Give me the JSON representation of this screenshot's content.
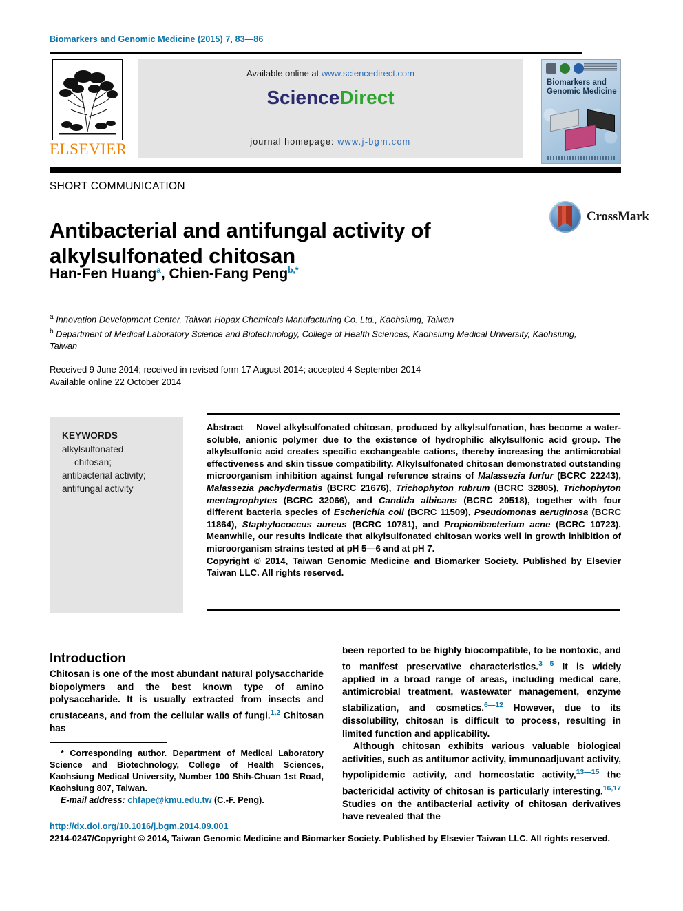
{
  "running_head": "Biomarkers and Genomic Medicine (2015) 7, 83—86",
  "masthead": {
    "available_prefix": "Available online at ",
    "available_url": "www.sciencedirect.com",
    "sciencedirect_science": "Science",
    "sciencedirect_direct": "Direct",
    "homepage_prefix": "journal homepage: ",
    "homepage_url": "www.j-bgm.com",
    "elsevier_label": "ELSEVIER",
    "cover_title": "Biomarkers and\nGenomic Medicine"
  },
  "article": {
    "type_label": "SHORT COMMUNICATION",
    "title": "Antibacterial and antifungal activity of alkylsulfonated chitosan",
    "authors_plain": "Han-Fen Huang a, Chien-Fang Peng b,*",
    "author_1": "Han-Fen Huang",
    "author_1_sup": "a",
    "author_2": "Chien-Fang Peng",
    "author_2_sup": "b,*",
    "crossmark_label": "CrossMark"
  },
  "affiliations": {
    "a_sup": "a",
    "a_text": "Innovation Development Center, Taiwan Hopax Chemicals Manufacturing Co. Ltd., Kaohsiung, Taiwan",
    "b_sup": "b",
    "b_text": "Department of Medical Laboratory Science and Biotechnology, College of Health Sciences, Kaohsiung Medical University, Kaohsiung, Taiwan"
  },
  "history": {
    "line1": "Received 9 June 2014; received in revised form 17 August 2014; accepted 4 September 2014",
    "line2": "Available online 22 October 2014"
  },
  "keywords": {
    "heading": "KEYWORDS",
    "line1": "alkylsulfonated",
    "line2": "chitosan;",
    "line3": "antibacterial activity;",
    "line4": "antifungal activity"
  },
  "abstract": {
    "label": "Abstract",
    "body_1": "Novel alkylsulfonated chitosan, produced by alkylsulfonation, has become a water-soluble, anionic polymer due to the existence of hydrophilic alkylsulfonic acid group. The alkylsulfonic acid creates specific exchangeable cations, thereby increasing the antimicrobial effectiveness and skin tissue compatibility. Alkylsulfonated chitosan demonstrated outstanding microorganism inhibition against fungal reference strains of ",
    "sp_1": "Malassezia furfur",
    "mid_1": " (BCRC 22243), ",
    "sp_2": "Malassezia pachydermatis",
    "mid_2": " (BCRC 21676), ",
    "sp_3": "Trichophyton rubrum",
    "mid_3": " (BCRC 32805), ",
    "sp_4": "Trichophyton mentagrophytes",
    "mid_4": " (BCRC 32066), and ",
    "sp_5": "Candida albicans",
    "mid_5": " (BCRC 20518), together with four different bacteria species of ",
    "sp_6": "Escherichia coli",
    "mid_6": " (BCRC 11509), ",
    "sp_7": "Pseudomonas aeruginosa",
    "mid_7": " (BCRC 11864), ",
    "sp_8": "Staphylococcus aureus",
    "mid_8": " (BCRC 10781), and ",
    "sp_9": "Propionibacterium acne",
    "mid_9": " (BCRC 10723). Meanwhile, our results indicate that alkylsulfonated chitosan works well in growth inhibition of microorganism strains tested at pH 5—6 and at pH 7.",
    "copyright": "Copyright © 2014, Taiwan Genomic Medicine and Biomarker Society. Published by Elsevier Taiwan LLC. All rights reserved."
  },
  "body": {
    "intro_heading": "Introduction",
    "left_p1_a": "Chitosan is one of the most abundant natural polysaccharide biopolymers and the best known type of amino polysaccharide. It is usually extracted from insects and crustaceans, and from the cellular walls of fungi.",
    "left_p1_ref": "1,2",
    "left_p1_b": " Chitosan has",
    "right_p1_a": "been reported to be highly biocompatible, to be nontoxic, and to manifest preservative characteristics.",
    "right_p1_ref1": "3—5",
    "right_p1_b": " It is widely applied in a broad range of areas, including medical care, antimicrobial treatment, wastewater management, enzyme stabilization, and cosmetics.",
    "right_p1_ref2": "6—12",
    "right_p1_c": " However, due to its dissolubility, chitosan is difficult to process, resulting in limited function and applicability.",
    "right_p2_a": "Although chitosan exhibits various valuable biological activities, such as antitumor activity, immunoadjuvant activity, hypolipidemic activity, and homeostatic activity,",
    "right_p2_ref1": "13—15",
    "right_p2_b": " the bactericidal activity of chitosan is particularly interesting.",
    "right_p2_ref2": "16,17",
    "right_p2_c": " Studies on the antibacterial activity of chitosan derivatives have revealed that the"
  },
  "footnote": {
    "line1": "* Corresponding author. Department of Medical Laboratory Science and Biotechnology, College of Health Sciences, Kaohsiung Medical University, Number 100 Shih-Chuan 1st Road, Kaohsiung 807, Taiwan.",
    "email_label": "E-mail address:",
    "email": "chfape@kmu.edu.tw",
    "email_suffix": " (C.-F. Peng)."
  },
  "footer": {
    "doi": "http://dx.doi.org/10.1016/j.bgm.2014.09.001",
    "copyright": "2214-0247/Copyright © 2014, Taiwan Genomic Medicine and Biomarker Society. Published by Elsevier Taiwan LLC. All rights reserved."
  },
  "colors": {
    "journal_blue": "#0b74a8",
    "link_blue": "#2a6ebb",
    "sciencedirect_green": "#2fa531",
    "sciencedirect_navy": "#2a2a6e",
    "elsevier_orange": "#F08000",
    "box_grey": "#e4e4e4"
  }
}
